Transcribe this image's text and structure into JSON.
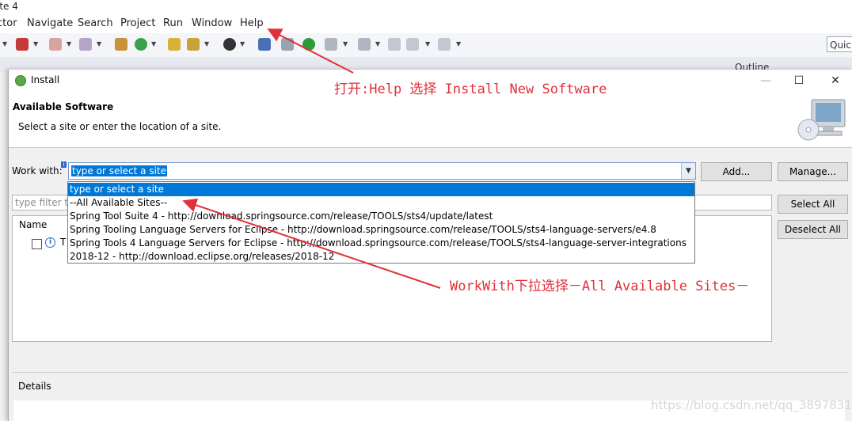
{
  "background_window": {
    "title": "ite 4",
    "menu": [
      "ctor",
      "Navigate",
      "Search",
      "Project",
      "Run",
      "Window",
      "Help"
    ],
    "quick_access": "Quic",
    "outline_tab": "Outline"
  },
  "dialog": {
    "title": "Install",
    "header_title": "Available Software",
    "header_subtitle": "Select a site or enter the location of a site.",
    "work_with_label": "Work with:",
    "combo_value": "type or select a site",
    "buttons": {
      "add": "Add...",
      "manage": "Manage...",
      "select_all": "Select All",
      "deselect_all": "Deselect All"
    },
    "filter_placeholder": "type filter te",
    "table": {
      "column_name": "Name",
      "row_text": "T"
    },
    "details_label": "Details",
    "window_controls": {
      "minimize": "—",
      "maximize": "☐",
      "close": "✕"
    }
  },
  "dropdown": {
    "items": [
      "type or select a site",
      "--All Available Sites--",
      "Spring Tool Suite 4 - http://download.springsource.com/release/TOOLS/sts4/update/latest",
      "Spring Tooling Language Servers for Eclipse - http://download.springsource.com/release/TOOLS/sts4-language-servers/e4.8",
      "Spring Tools 4 Language Servers for Eclipse - http://download.springsource.com/release/TOOLS/sts4-language-server-integrations",
      "2018-12 - http://download.eclipse.org/releases/2018-12"
    ],
    "selected_index": 0
  },
  "annotations": {
    "help_note": "打开:Help 选择 Install New Software",
    "workwith_note": "WorkWith下拉选择－All Available Sites－"
  },
  "watermark": "https://blog.csdn.net/qq_3897831",
  "colors": {
    "selection": "#0078d7",
    "annotation": "#e0303a"
  }
}
